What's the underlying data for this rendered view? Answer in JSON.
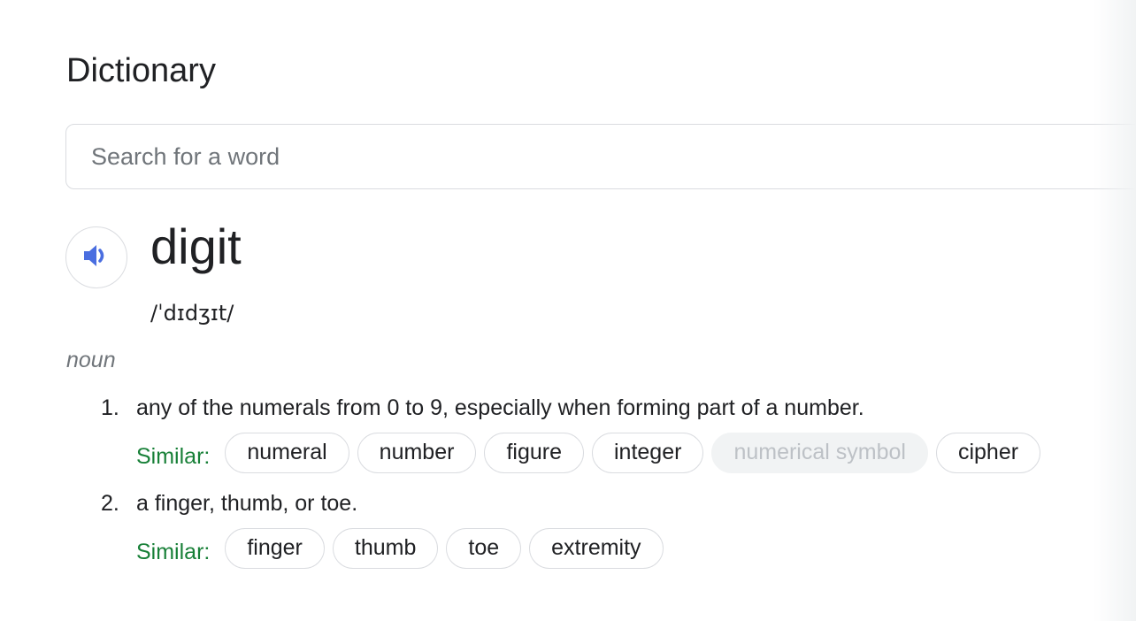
{
  "header": {
    "title": "Dictionary"
  },
  "search": {
    "placeholder": "Search for a word",
    "value": ""
  },
  "entry": {
    "word": "digit",
    "pronounce_icon": "speaker-icon",
    "phonetic": "/ˈdɪdʒɪt/",
    "part_of_speech": "noun",
    "accent_color": "#4a6ee0",
    "similar_color": "#188038",
    "definitions": [
      {
        "number": "1.",
        "text": "any of the numerals from 0 to 9, especially when forming part of a number.",
        "similar_label": "Similar:",
        "similar": [
          {
            "label": "numeral",
            "enabled": true
          },
          {
            "label": "number",
            "enabled": true
          },
          {
            "label": "figure",
            "enabled": true
          },
          {
            "label": "integer",
            "enabled": true
          },
          {
            "label": "numerical symbol",
            "enabled": false
          },
          {
            "label": "cipher",
            "enabled": true
          }
        ]
      },
      {
        "number": "2.",
        "text": "a finger, thumb, or toe.",
        "similar_label": "Similar:",
        "similar": [
          {
            "label": "finger",
            "enabled": true
          },
          {
            "label": "thumb",
            "enabled": true
          },
          {
            "label": "toe",
            "enabled": true
          },
          {
            "label": "extremity",
            "enabled": true
          }
        ]
      }
    ]
  }
}
